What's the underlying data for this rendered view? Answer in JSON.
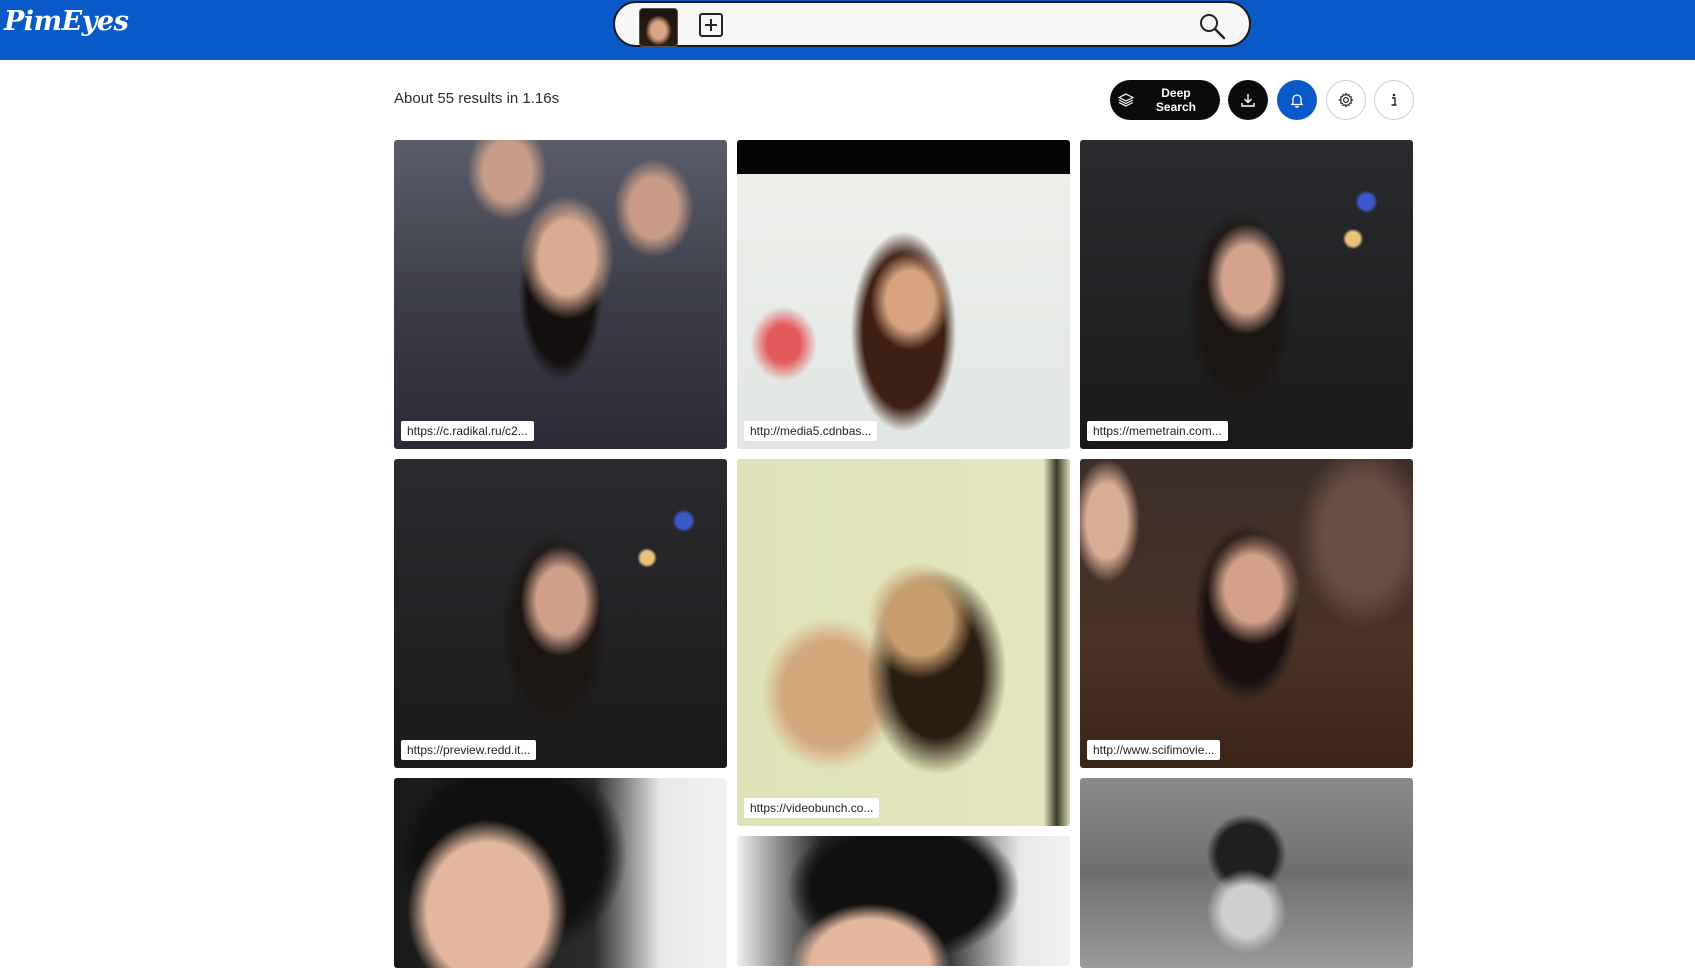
{
  "header": {
    "logo_text": "PimEyes",
    "brand_color": "#0a59c9",
    "search": {
      "thumbnail_alt": "uploaded face image",
      "add_icon": "plus-square-icon",
      "search_icon": "magnifier-icon"
    }
  },
  "results": {
    "summary": "About 55 results in 1.16s",
    "toolbar": {
      "deep_search_label": "Deep Search",
      "deep_search_icon": "layers-icon",
      "download_icon": "download-icon",
      "alert_icon": "bell-icon",
      "settings_icon": "gear-icon",
      "info_icon": "info-icon"
    },
    "items": [
      {
        "url": "https://c.radikal.ru/c2..."
      },
      {
        "url": "http://media5.cdnbas..."
      },
      {
        "url": "https://memetrain.com..."
      },
      {
        "url": "https://preview.redd.it..."
      },
      {
        "url": "https://videobunch.co..."
      },
      {
        "url": "http://www.scifimovie..."
      },
      {
        "url": ""
      },
      {
        "url": ""
      },
      {
        "url": ""
      }
    ]
  }
}
